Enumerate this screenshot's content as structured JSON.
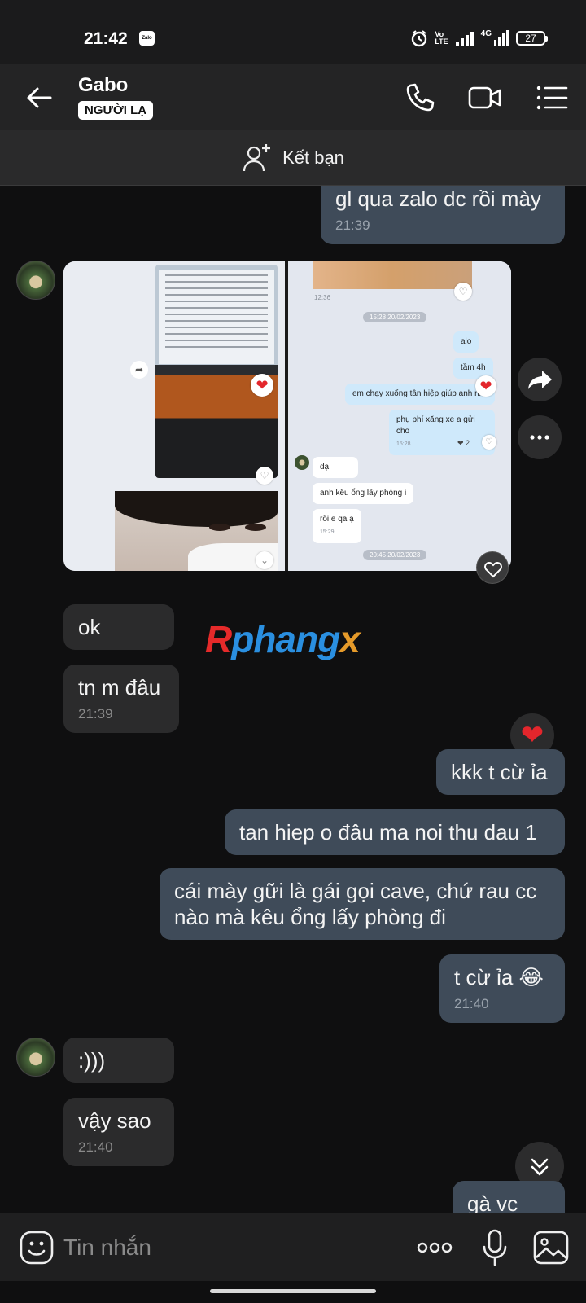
{
  "status_bar": {
    "time": "21:42",
    "app_badge": "Zalo",
    "network_top": "Vo",
    "network_bottom": "LTE",
    "signal_label": "4G",
    "battery": "27"
  },
  "header": {
    "name": "Gabo",
    "badge": "NGƯỜI LẠ"
  },
  "friend_bar": {
    "label": "Kết bạn"
  },
  "messages": {
    "m1": {
      "text": "gl qua zalo dc rồi mày",
      "time": "21:39"
    },
    "m2": {
      "text": "ok"
    },
    "m3": {
      "text": "tn m đâu",
      "time": "21:39"
    },
    "m4": {
      "text": "kkk t cừ ỉa"
    },
    "m5": {
      "text": "tan hiep o đâu ma noi thu dau 1"
    },
    "m6": {
      "line1": "cái mày gữi là gái gọi cave, chứ rau cc",
      "line2": "nào mà kêu ổng lấy phòng đi"
    },
    "m7": {
      "text": "t cừ ỉa 😂",
      "time": "21:40"
    },
    "m8": {
      "text": ":)))"
    },
    "m9": {
      "text": "vậy sao",
      "time": "21:40"
    },
    "m10": {
      "text": "gà vc"
    }
  },
  "photo": {
    "left_time": "12:36",
    "date1": "15:28 20/02/2023",
    "b_alo": "alo",
    "b_tam": "tầm 4h",
    "b_chay": "em chạy xuống tân hiệp giúp anh nha",
    "b_phuphi": "phụ phí xăng xe a gửi cho",
    "b_phuphi_time": "15:28",
    "heart_count": "2",
    "b_da": "dạ",
    "b_anhkeu": "anh kêu ổng lấy phòng i",
    "b_roi": "rồi e qa ạ",
    "b_roi_time": "15:29",
    "date2": "20:45 20/02/2023"
  },
  "watermark": {
    "part1": "R",
    "part2": "phang",
    "part3": "x"
  },
  "composer": {
    "placeholder": "Tin nhắn"
  },
  "colors": {
    "outgoing": "#3f4b59",
    "incoming": "#2b2b2c",
    "accent_red": "#e3262c"
  }
}
